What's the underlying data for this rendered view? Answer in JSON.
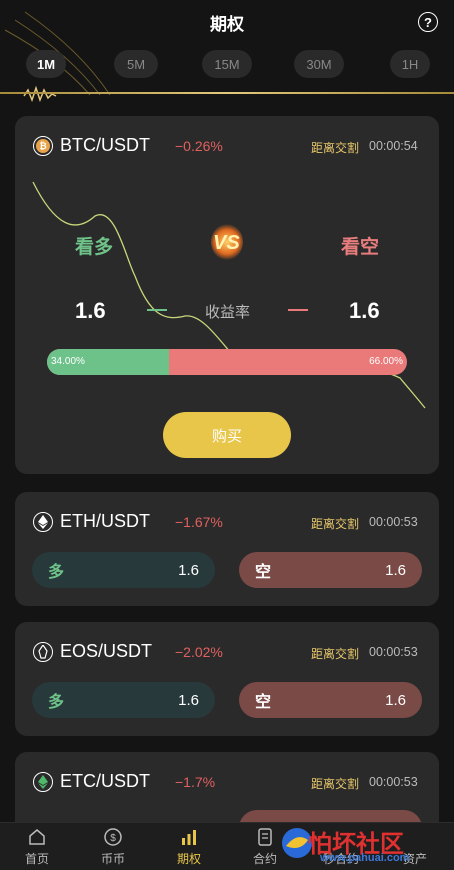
{
  "header": {
    "title": "期权",
    "help": "?"
  },
  "timeframes": [
    {
      "label": "1M",
      "active": true
    },
    {
      "label": "5M",
      "active": false
    },
    {
      "label": "15M",
      "active": false
    },
    {
      "label": "30M",
      "active": false
    },
    {
      "label": "1H",
      "active": false
    }
  ],
  "featured": {
    "pair": "BTC/USDT",
    "change": "-0.26%",
    "countdown_label": "距离交割",
    "countdown": "00:00:54",
    "bull_label": "看多",
    "bear_label": "看空",
    "vs": "VS",
    "bull_rate": "1.6",
    "bear_rate": "1.6",
    "yield_label": "收益率",
    "bull_percent_text": "34.00%",
    "bear_percent_text": "66.00%",
    "bull_fraction": 0.34,
    "buy_label": "购买"
  },
  "contracts": [
    {
      "pair": "ETH/USDT",
      "change": "-1.67%",
      "countdown_label": "距离交割",
      "countdown": "00:00:53",
      "long_label": "多",
      "long_rate": "1.6",
      "short_label": "空",
      "short_rate": "1.6"
    },
    {
      "pair": "EOS/USDT",
      "change": "-2.02%",
      "countdown_label": "距离交割",
      "countdown": "00:00:53",
      "long_label": "多",
      "long_rate": "1.6",
      "short_label": "空",
      "short_rate": "1.6"
    },
    {
      "pair": "ETC/USDT",
      "change": "-1.7%",
      "countdown_label": "距离交割",
      "countdown": "00:00:53"
    }
  ],
  "nav": [
    {
      "label": "首页",
      "icon": "home-icon",
      "active": false
    },
    {
      "label": "币币",
      "icon": "coin-icon",
      "active": false
    },
    {
      "label": "期权",
      "icon": "bar-chart-icon",
      "active": true
    },
    {
      "label": "合约",
      "icon": "document-icon",
      "active": false
    },
    {
      "label": "秒合约",
      "icon": "",
      "active": false
    },
    {
      "label": "资产",
      "icon": "",
      "active": false
    }
  ],
  "watermark": {
    "text": "怕坏社区",
    "url": "www.pahuai.com"
  },
  "colors": {
    "accent": "#e8c64a",
    "bull": "#6dc28a",
    "bear": "#ea7a7a",
    "background": "#141414",
    "card": "#2a2a2a"
  }
}
